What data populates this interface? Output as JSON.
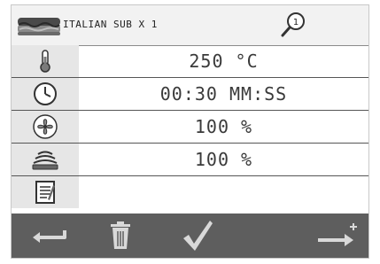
{
  "header": {
    "product_name": "ITALIAN SUB X 1",
    "search_badge": "1"
  },
  "rows": [
    {
      "icon": "thermometer-icon",
      "value": "250 °C"
    },
    {
      "icon": "clock-icon",
      "value": "00:30 MM:SS"
    },
    {
      "icon": "fan-icon",
      "value": "100 %"
    },
    {
      "icon": "microwave-waves-icon",
      "value": "100 %"
    },
    {
      "icon": "notes-icon",
      "value": ""
    }
  ],
  "footer": {
    "buttons": [
      "back-button",
      "delete-button",
      "confirm-button",
      "add-step-button"
    ]
  },
  "colors": {
    "footer_bg": "#5e5e5e",
    "icon_cell_bg": "#e6e6e6",
    "footer_icon": "#d9d9d9"
  }
}
